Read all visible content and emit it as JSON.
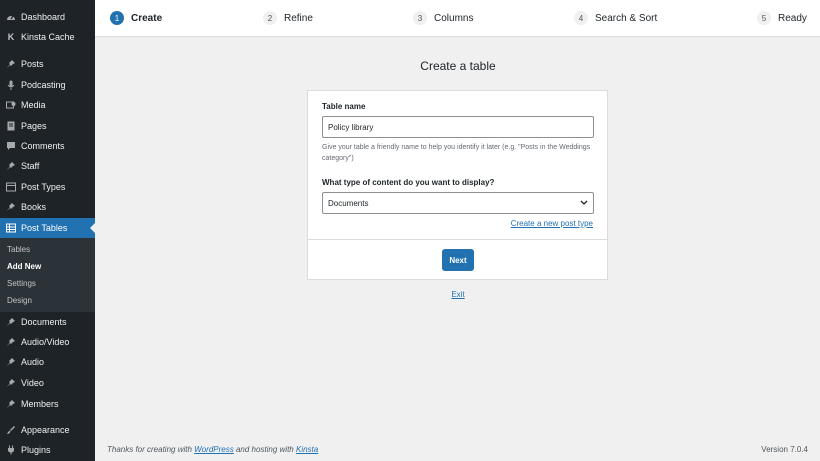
{
  "sidebar": {
    "items": [
      {
        "label": "Dashboard",
        "icon": "dashboard-icon"
      },
      {
        "label": "Kinsta Cache",
        "icon": "kinsta-icon"
      },
      {
        "label": "Posts",
        "icon": "pin-icon"
      },
      {
        "label": "Podcasting",
        "icon": "microphone-icon"
      },
      {
        "label": "Media",
        "icon": "media-icon"
      },
      {
        "label": "Pages",
        "icon": "page-icon"
      },
      {
        "label": "Comments",
        "icon": "comment-icon"
      },
      {
        "label": "Staff",
        "icon": "pin-icon"
      },
      {
        "label": "Post Types",
        "icon": "post-types-icon"
      },
      {
        "label": "Books",
        "icon": "pin-icon"
      },
      {
        "label": "Post Tables",
        "icon": "table-icon"
      },
      {
        "label": "Documents",
        "icon": "pin-icon"
      },
      {
        "label": "Audio/Video",
        "icon": "pin-icon"
      },
      {
        "label": "Audio",
        "icon": "pin-icon"
      },
      {
        "label": "Video",
        "icon": "pin-icon"
      },
      {
        "label": "Members",
        "icon": "pin-icon"
      },
      {
        "label": "Appearance",
        "icon": "paintbrush-icon"
      },
      {
        "label": "Plugins",
        "icon": "plugin-icon"
      }
    ],
    "submenu": [
      {
        "label": "Tables"
      },
      {
        "label": "Add New"
      },
      {
        "label": "Settings"
      },
      {
        "label": "Design"
      }
    ]
  },
  "stepper": {
    "steps": [
      {
        "num": "1",
        "label": "Create"
      },
      {
        "num": "2",
        "label": "Refine"
      },
      {
        "num": "3",
        "label": "Columns"
      },
      {
        "num": "4",
        "label": "Search & Sort"
      },
      {
        "num": "5",
        "label": "Ready"
      }
    ]
  },
  "main": {
    "title": "Create a table",
    "table_name_label": "Table name",
    "table_name_value": "Policy library",
    "table_name_help": "Give your table a friendly name to help you identify it later (e.g. \"Posts in the Weddings category\")",
    "content_type_label": "What type of content do you want to display?",
    "content_type_value": "Documents",
    "create_post_type_link": "Create a new post type",
    "next_label": "Next",
    "exit_label": "Exit"
  },
  "footer": {
    "prefix": "Thanks for creating with ",
    "wordpress_link": "WordPress",
    "middle": " and hosting with ",
    "kinsta_link": "Kinsta",
    "version": "Version 7.0.4"
  },
  "colors": {
    "sidebar_bg": "#1d2327",
    "accent": "#2271b1",
    "page_bg": "#f0f0f1"
  }
}
